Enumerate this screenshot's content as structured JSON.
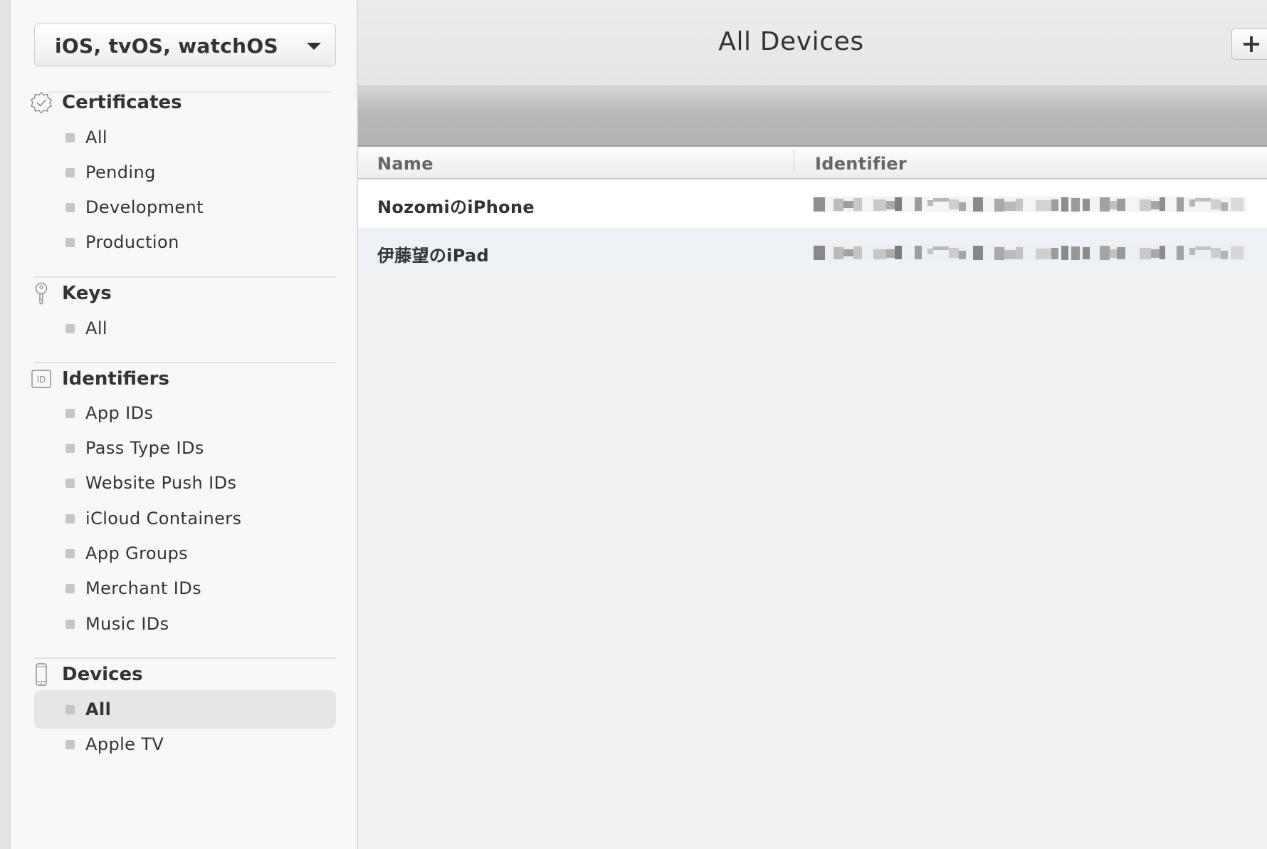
{
  "sidebar": {
    "platform_select": "iOS, tvOS, watchOS",
    "sections": {
      "certificates": {
        "title": "Certificates",
        "items": [
          "All",
          "Pending",
          "Development",
          "Production"
        ]
      },
      "keys": {
        "title": "Keys",
        "items": [
          "All"
        ]
      },
      "identifiers": {
        "title": "Identifiers",
        "icon_text": "ID",
        "items": [
          "App IDs",
          "Pass Type IDs",
          "Website Push IDs",
          "iCloud Containers",
          "App Groups",
          "Merchant IDs",
          "Music IDs"
        ]
      },
      "devices": {
        "title": "Devices",
        "items": [
          "All",
          "Apple TV"
        ],
        "active_item": "All"
      }
    }
  },
  "main": {
    "title": "All Devices",
    "add_label": "+",
    "table": {
      "columns": [
        "Name",
        "Identifier"
      ],
      "rows": [
        {
          "name": "NozomiのiPhone",
          "identifier": ""
        },
        {
          "name": "伊藤望のiPad",
          "identifier": ""
        }
      ]
    }
  },
  "colors": {
    "sidebar_bg": "#f7f9f9",
    "main_bg": "#f1f1f1",
    "active_item_bg": "#e6e6e6",
    "row_alt_bg": "#eef1f5",
    "bullet": "#c6c6c6",
    "text": "#333333"
  },
  "icons": {
    "certificates": "certificate-badge-icon",
    "keys": "key-icon",
    "identifiers": "id-box-icon",
    "devices": "phone-icon",
    "platform_select": "caret-down-icon",
    "add": "plus-icon"
  }
}
